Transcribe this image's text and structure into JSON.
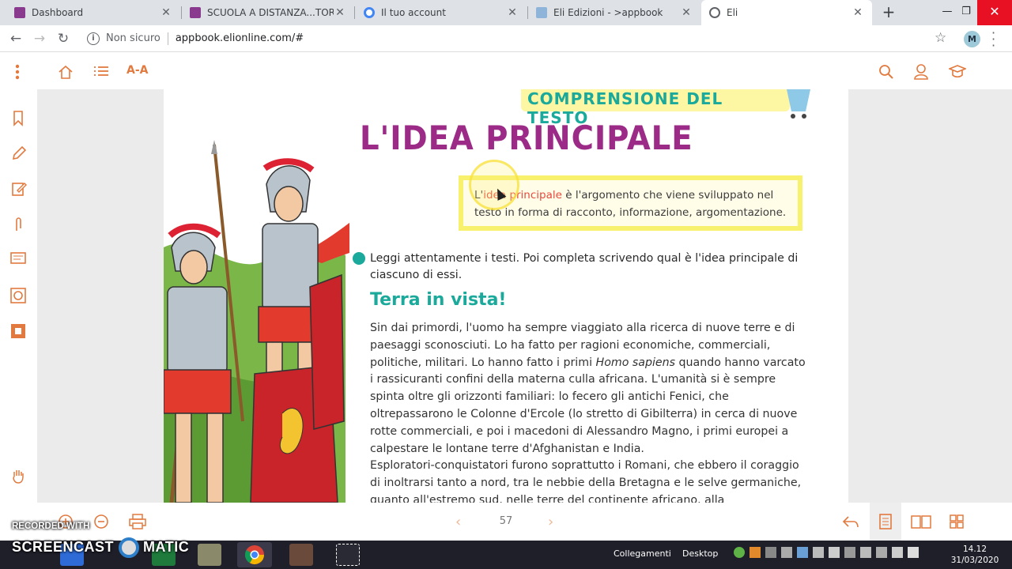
{
  "browser": {
    "tabs": [
      {
        "title": "Dashboard",
        "color": "#8a3a8e"
      },
      {
        "title": "SCUOLA A DISTANZA...TORRE - M",
        "color": "#8a3a8e"
      },
      {
        "title": "Il tuo account",
        "color": "#4285f4"
      },
      {
        "title": "Eli Edizioni - >appbook",
        "color": "#1a73e8"
      },
      {
        "title": "Eli",
        "color": "#5f6368"
      }
    ],
    "security_label": "Non sicuro",
    "url": "appbook.elionline.com/#",
    "avatar_initial": "M"
  },
  "app": {
    "text_size_label": "A-A",
    "page_number": "57"
  },
  "page": {
    "banner": "COMPRENSIONE DEL TESTO",
    "headline": "L'IDEA PRINCIPALE",
    "definition": {
      "prefix": "L'",
      "highlight": "idea principale",
      "rest": " è l'argomento che viene sviluppato nel testo in forma di racconto, informazione, argomentazione."
    },
    "instruction": "Leggi attentamente i testi. Poi completa scrivendo qual è l'idea principale di ciascuno di essi.",
    "subheading": "Terra in vista!",
    "paragraph1_a": "Sin dai primordi, l'uomo ha sempre viaggiato alla ricerca di nuove terre e di paesaggi sconosciuti. Lo ha fatto per ragioni economiche, commerciali, politiche, militari. Lo hanno fatto i primi ",
    "paragraph1_em": "Homo sapiens",
    "paragraph1_b": " quando hanno varcato i rassicuranti confini della materna culla africana. L'umanità si è sempre spinta oltre gli orizzonti familiari: lo fecero gli antichi Fenici, che oltrepassarono le Colonne d'Ercole (lo stretto di Gibilterra) in cerca di nuove rotte commerciali, e poi i macedoni di Alessandro Magno, i primi europei a calpestare le lontane terre d'Afghanistan e India.",
    "paragraph2": "Esploratori-conquistatori furono soprattutto i Romani, che ebbero il coraggio di inoltrarsi tanto a nord, tra le nebbie della Bretagna e le selve germaniche, quanto all'estremo sud, nelle terre del continente africano, alla"
  },
  "watermark": {
    "line1": "RECORDED WITH",
    "line2": "SCREENCAST",
    "line3": "MATIC"
  },
  "taskbar": {
    "links_label": "Collegamenti",
    "desktop_label": "Desktop",
    "time": "14.12",
    "date": "31/03/2020"
  },
  "colors": {
    "accent": "#e27a3f",
    "headline": "#9b2b86",
    "teal": "#1aa99a"
  }
}
